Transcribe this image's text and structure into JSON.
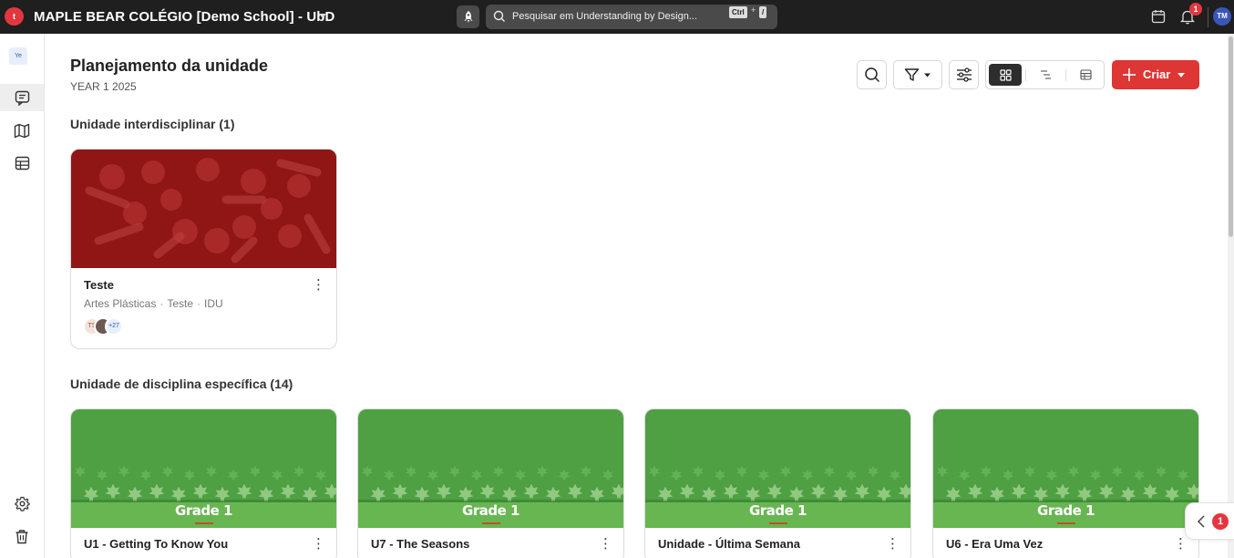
{
  "topbar": {
    "logo_text": "t",
    "school_title": "MAPLE BEAR COLÉGIO [Demo School] - UbD",
    "search_placeholder": "Pesquisar em Understanding by Design...",
    "shortcut_key1": "Ctrl",
    "shortcut_plus": "+",
    "shortcut_key2": "/",
    "notification_count": "1",
    "user_initials": "TM"
  },
  "sidebar": {
    "year_chip": "Ye",
    "items": [
      {
        "icon": "chat-icon",
        "active": true
      },
      {
        "icon": "map-icon",
        "active": false
      },
      {
        "icon": "table-icon",
        "active": false
      }
    ],
    "bottom": [
      {
        "icon": "gear-icon"
      },
      {
        "icon": "trash-icon"
      }
    ]
  },
  "page": {
    "title": "Planejamento da unidade",
    "subtitle": "YEAR 1 2025"
  },
  "toolbar": {
    "create_label": "Criar",
    "accent_color": "#de3535"
  },
  "sections": {
    "interdisciplinary": {
      "title": "Unidade interdisciplinar (1)",
      "cards": [
        {
          "title": "Teste",
          "meta": [
            "Artes Plásticas",
            "Teste",
            "IDU"
          ],
          "collaborator_initials": "TS",
          "collaborator_extra": "+27"
        }
      ]
    },
    "specific": {
      "title": "Unidade de disciplina específica (14)",
      "cards": [
        {
          "title": "U1 - Getting To Know You",
          "cover_label": "Grade 1"
        },
        {
          "title": "U7 - The Seasons",
          "cover_label": "Grade 1"
        },
        {
          "title": "Unidade - Última Semana",
          "cover_label": "Grade 1"
        },
        {
          "title": "U6 - Era Uma Vez",
          "cover_label": "Grade 1"
        }
      ]
    }
  },
  "widget": {
    "badge_count": "1"
  }
}
